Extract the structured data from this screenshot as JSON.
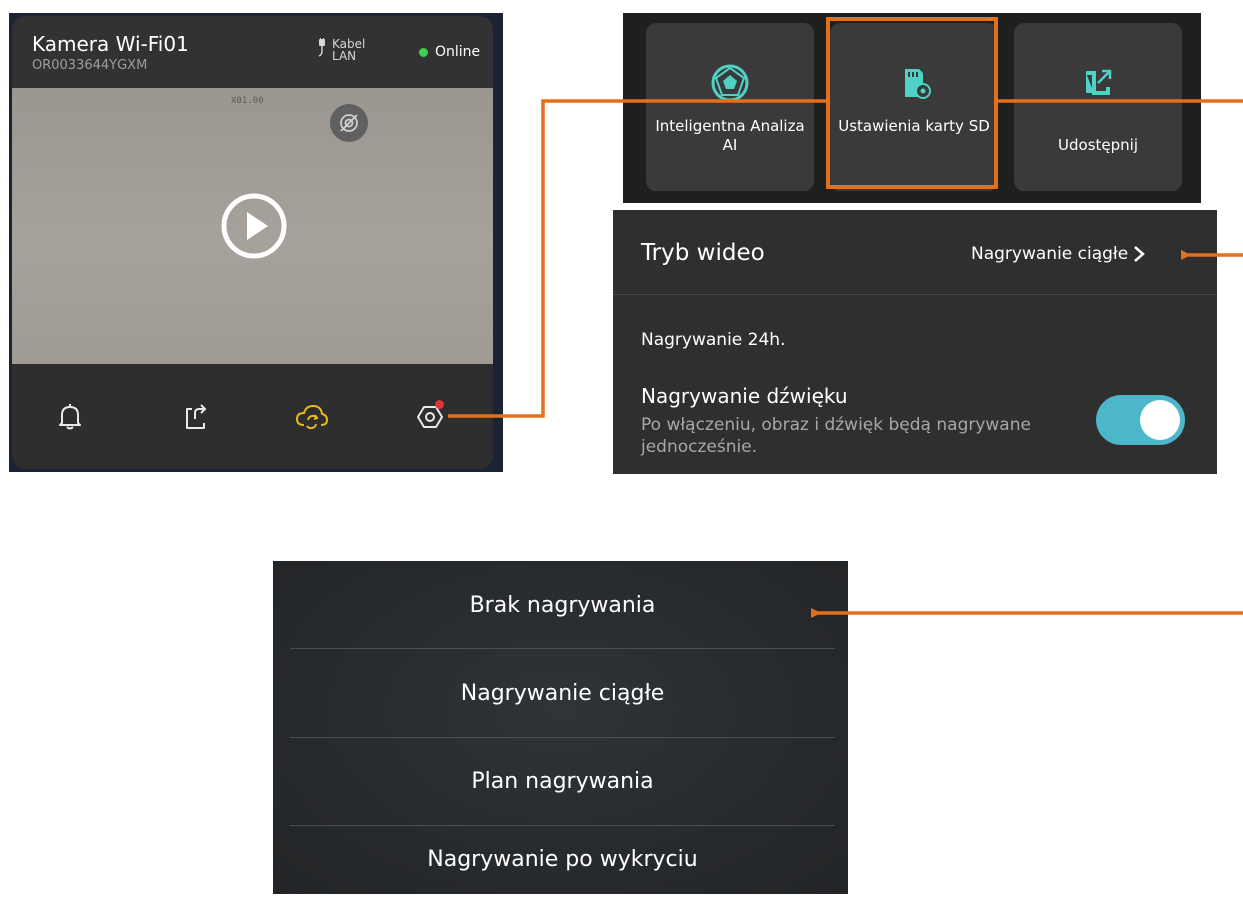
{
  "camera": {
    "name": "Kamera Wi-Fi01",
    "serial": "OR0033644YGXM",
    "connection_label": "Kabel LAN",
    "status": "Online",
    "osd_zoom": "X01.00",
    "toolbar": [
      {
        "icon": "bell-icon"
      },
      {
        "icon": "share-icon"
      },
      {
        "icon": "cloud-playback-icon"
      },
      {
        "icon": "settings-icon",
        "has_notification": true
      }
    ]
  },
  "tiles": [
    {
      "label": "Inteligentna Analiza AI",
      "icon": "ai-analysis-icon"
    },
    {
      "label": "Ustawienia karty SD",
      "icon": "sd-card-settings-icon",
      "highlighted": true
    },
    {
      "label": "Udostępnij",
      "icon": "share-icon"
    }
  ],
  "settings": {
    "video_mode_title": "Tryb wideo",
    "video_mode_value": "Nagrywanie ciągłe",
    "recording_info": "Nagrywanie 24h.",
    "sound_title": "Nagrywanie dźwięku",
    "sound_description": "Po włączeniu, obraz i dźwięk będą nagrywane jednocześnie.",
    "sound_enabled": true
  },
  "recording_options": [
    "Brak nagrywania",
    "Nagrywanie ciągłe",
    "Plan nagrywania",
    "Nagrywanie po wykryciu"
  ],
  "colors": {
    "accent_orange": "#e4701c",
    "toggle_on": "#4bb7c8",
    "online_green": "#3ed24c",
    "cloud_yellow": "#e8b91c",
    "notification_red": "#e3342f"
  }
}
